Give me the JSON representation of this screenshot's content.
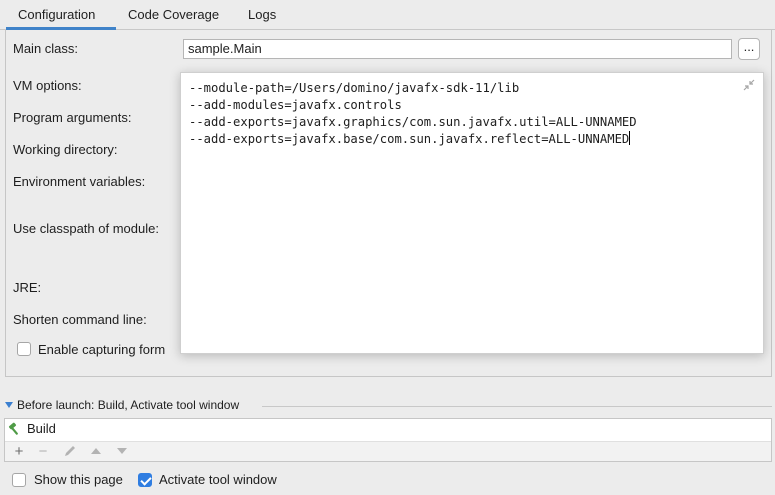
{
  "tabs": [
    {
      "label": "Configuration"
    },
    {
      "label": "Code Coverage"
    },
    {
      "label": "Logs"
    }
  ],
  "form": {
    "main_class_label": "Main class:",
    "main_class_value": "sample.Main",
    "browse_label": "...",
    "vm_options_label": "VM options:",
    "program_arguments_label": "Program arguments:",
    "working_directory_label": "Working directory:",
    "environment_variables_label": "Environment variables:",
    "use_classpath_label": "Use classpath of module:",
    "jre_label": "JRE:",
    "shorten_command_line_label": "Shorten command line:",
    "enable_capturing_label": "Enable capturing form",
    "enable_capturing_checked": false
  },
  "vm_options_editor": {
    "lines": [
      "--module-path=/Users/domino/javafx-sdk-11/lib",
      "--add-modules=javafx.controls",
      "--add-exports=javafx.graphics/com.sun.javafx.util=ALL-UNNAMED",
      "--add-exports=javafx.base/com.sun.javafx.reflect=ALL-UNNAMED"
    ]
  },
  "before_launch": {
    "title": "Before launch: Build, Activate tool window",
    "tasks": [
      {
        "label": "Build"
      }
    ],
    "toolbar": [
      "add-icon",
      "remove-icon",
      "edit-icon",
      "move-up-icon",
      "move-down-icon"
    ]
  },
  "footer": {
    "show_this_page_label": "Show this page",
    "show_this_page_checked": false,
    "activate_tool_window_label": "Activate tool window",
    "activate_tool_window_checked": true
  },
  "colors": {
    "accent": "#2f7de1",
    "tab_underline": "#4083c9",
    "background": "#ececec"
  }
}
